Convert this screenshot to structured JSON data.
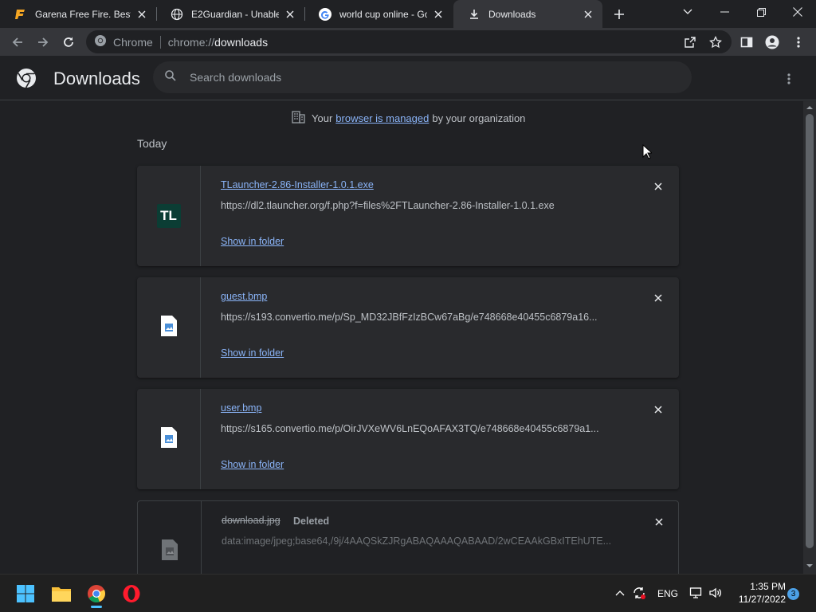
{
  "tabs": [
    {
      "title": "Garena Free Fire. Best s",
      "icon": "free-fire-icon",
      "active": false
    },
    {
      "title": "E2Guardian - Unable to",
      "icon": "globe-icon",
      "active": false
    },
    {
      "title": "world cup online - Goo",
      "icon": "google-icon",
      "active": false
    },
    {
      "title": "Downloads",
      "icon": "download-icon",
      "active": true
    }
  ],
  "omnibox": {
    "site_label": "Chrome",
    "url_scheme": "chrome://",
    "url_host": "downloads"
  },
  "page": {
    "title": "Downloads",
    "search_placeholder": "Search downloads"
  },
  "managed": {
    "prefix": "Your",
    "link": "browser is managed",
    "suffix": "by your organization"
  },
  "section_today": "Today",
  "downloads": [
    {
      "name": "TLauncher-2.86-Installer-1.0.1.exe",
      "url": "https://dl2.tlauncher.org/f.php?f=files%2FTLauncher-2.86-Installer-1.0.1.exe",
      "action": "Show in folder",
      "icon_text": "TL"
    },
    {
      "name": "guest.bmp",
      "url": "https://s193.convertio.me/p/Sp_MD32JBfFzIzBCw67aBg/e748668e40455c6879a16...",
      "action": "Show in folder"
    },
    {
      "name": "user.bmp",
      "url": "https://s165.convertio.me/p/OirJVXeWV6LnEQoAFAX3TQ/e748668e40455c6879a1...",
      "action": "Show in folder"
    },
    {
      "name": "download.jpg",
      "status": "Deleted",
      "url": "data:image/jpeg;base64,/9j/4AAQSkZJRgABAQAAAQABAAD/2wCEAAkGBxITEhUTE..."
    }
  ],
  "taskbar": {
    "lang": "ENG",
    "time": "1:35 PM",
    "date": "11/27/2022",
    "notifications": "3"
  },
  "colors": {
    "accent_link": "#8ab4f8",
    "background": "#202124",
    "card": "#292a2d"
  }
}
